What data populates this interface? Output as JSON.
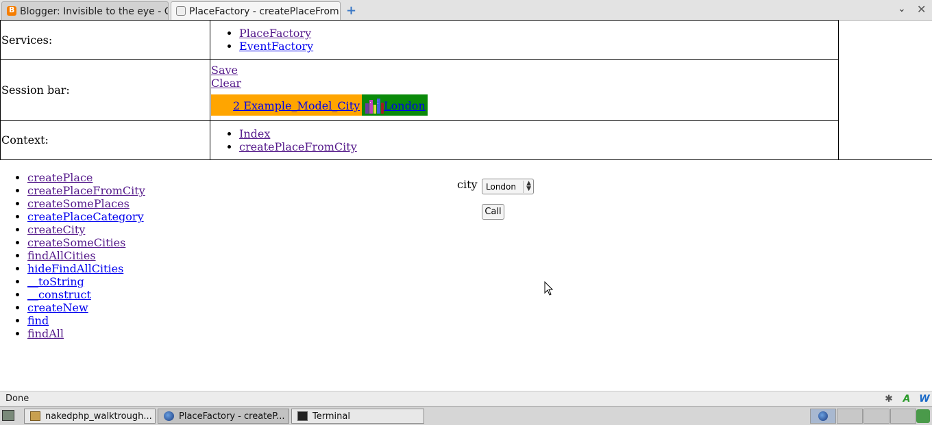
{
  "tabs": [
    {
      "title": "Blogger: Invisible to the eye - Cr...",
      "active": false,
      "icon": "blogger-icon"
    },
    {
      "title": "PlaceFactory - createPlaceFrom...",
      "active": true,
      "icon": "page-icon"
    }
  ],
  "tab_controls": {
    "new_tab": "+",
    "list": "⌄",
    "close": "✕"
  },
  "table": {
    "services": {
      "label": "Services:",
      "links": [
        "PlaceFactory",
        "EventFactory"
      ]
    },
    "session": {
      "label": "Session bar:",
      "save": "Save",
      "clear": "Clear",
      "items": [
        "2 Example_Model_City",
        "London"
      ],
      "colors": {
        "first": "#ffa500",
        "second": "#0a8a0a"
      }
    },
    "context": {
      "label": "Context:",
      "links": [
        "Index",
        "createPlaceFromCity"
      ]
    }
  },
  "methods": [
    "createPlace",
    "createPlaceFromCity",
    "createSomePlaces",
    "createPlaceCategory",
    "createCity",
    "createSomeCities",
    "findAllCities",
    "hideFindAllCities",
    "__toString",
    "__construct",
    "createNew",
    "find",
    "findAll"
  ],
  "form": {
    "city_label": "city",
    "city_value": "London",
    "call_label": "Call"
  },
  "status": {
    "text": "Done"
  },
  "taskbar": {
    "tasks": [
      {
        "label": "nakedphp_walktrough...",
        "active": false
      },
      {
        "label": "PlaceFactory - createP...",
        "active": true
      },
      {
        "label": "Terminal",
        "active": false
      }
    ]
  }
}
